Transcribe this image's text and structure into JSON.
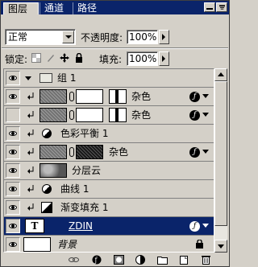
{
  "tabs": [
    {
      "label": "图层",
      "active": true
    },
    {
      "label": "通道",
      "active": false
    },
    {
      "label": "路径",
      "active": false
    }
  ],
  "blend": {
    "mode": "正常",
    "opacity_label": "不透明度:",
    "opacity_value": "100%"
  },
  "lock": {
    "label": "锁定:",
    "fill_label": "填充:",
    "fill_value": "100%"
  },
  "layers": [
    {
      "name": "组 1",
      "type": "group",
      "visible": true
    },
    {
      "name": "杂色",
      "type": "noise-masked",
      "visible": true,
      "fx": true
    },
    {
      "name": "杂色",
      "type": "noise-masked",
      "visible": false,
      "fx": true
    },
    {
      "name": "色彩平衡 1",
      "type": "adjustment",
      "visible": true
    },
    {
      "name": "杂色",
      "type": "noise-dark",
      "visible": true,
      "fx": true
    },
    {
      "name": "分层云",
      "type": "clouds",
      "visible": true
    },
    {
      "name": "曲线 1",
      "type": "adjustment",
      "visible": true
    },
    {
      "name": "渐变填充 1",
      "type": "gradient",
      "visible": true
    },
    {
      "name": "ZDIN",
      "type": "text",
      "visible": true,
      "fx": true,
      "selected": true,
      "thumb_letter": "T"
    },
    {
      "name": "背景",
      "type": "background",
      "visible": true,
      "locked": true
    }
  ],
  "icons": {
    "eye": "eye-icon",
    "fx": "fx-icon",
    "lock": "lock-icon",
    "link": "link-icon"
  },
  "colors": {
    "selection": "#0a246a",
    "panel": "#d4d0c8"
  }
}
